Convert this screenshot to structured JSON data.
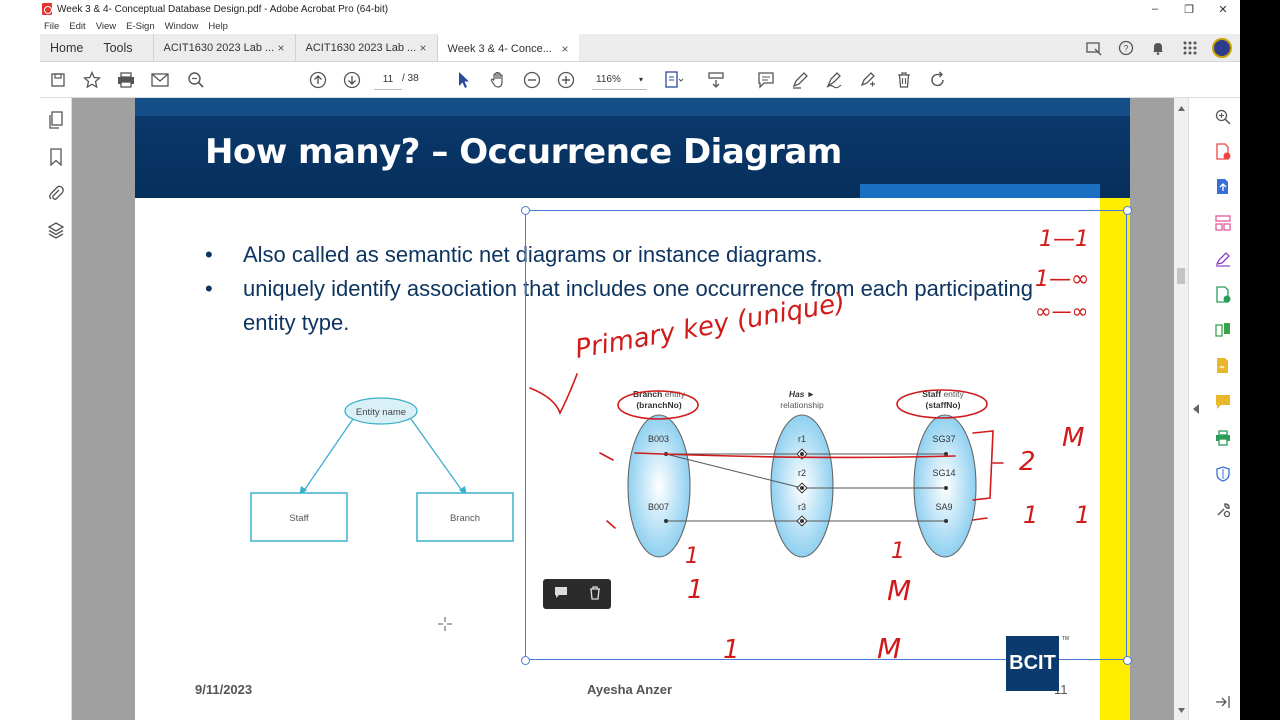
{
  "window": {
    "title": "Week 3 & 4- Conceptual Database Design.pdf - Adobe Acrobat Pro (64-bit)",
    "minimize": "–",
    "restore": "❐",
    "close": "✕"
  },
  "menu": [
    "File",
    "Edit",
    "View",
    "E-Sign",
    "Window",
    "Help"
  ],
  "tabs": {
    "home": "Home",
    "tools": "Tools",
    "documents": [
      {
        "label": "ACIT1630 2023 Lab ...",
        "close": "×"
      },
      {
        "label": "ACIT1630 2023 Lab ...",
        "close": "×"
      },
      {
        "label": "Week 3 & 4- Conce...",
        "close": "×"
      }
    ]
  },
  "toolbar": {
    "page_current": "11",
    "page_total": "/ 38",
    "zoom": "116%",
    "zoom_arrow": "▾"
  },
  "slide": {
    "title": "How many? – Occurrence Diagram",
    "bullets": [
      "Also called as semantic net diagrams or instance diagrams.",
      "uniquely identify association that includes one occurrence from each participating entity type."
    ],
    "er": {
      "entity_name": "Entity name",
      "left_box": "Staff",
      "right_box": "Branch"
    },
    "occurrence": {
      "branch_header_bold": "Branch",
      "branch_header_rest": " entity",
      "branch_key": "(branchNo)",
      "has_header": "Has ►",
      "rel_header": "relationship",
      "staff_header_bold": "Staff",
      "staff_header_rest": " entity",
      "staff_key": "(staffNo)",
      "branches": [
        "B003",
        "B007"
      ],
      "relations": [
        "r1",
        "r2",
        "r3"
      ],
      "staff": [
        "SG37",
        "SG14",
        "SA9"
      ]
    },
    "footer_date": "9/11/2023",
    "footer_author": "Ayesha Anzer",
    "footer_page": "11",
    "logo": "BCIT",
    "logo_tm": "TM"
  },
  "handwriting": {
    "primary_key": "Primary key (unique)",
    "ratio_1_1": "1—1",
    "ratio_1_inf": "1—∞",
    "ratio_inf_inf": "∞—∞",
    "bracket_two": "2",
    "bracket_m": "M",
    "row_one_a": "1",
    "row_one_b": "1",
    "under_one_a": "1",
    "under_one_b": "1",
    "under_m_a": "M",
    "under_one_c": "1",
    "under_m_b": "M"
  },
  "colors": {
    "slide_header": "#0b3a6e",
    "slide_text": "#0d3560",
    "ink_red": "#d11a1a",
    "er_teal": "#3bb0cc",
    "yellow_bar": "#ffee00",
    "selection_blue": "#4a7bd4"
  }
}
